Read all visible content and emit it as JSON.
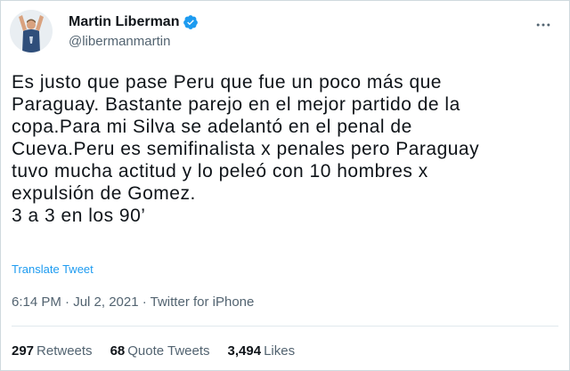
{
  "author": {
    "display_name": "Martin Liberman",
    "handle": "@libermanmartin",
    "verified": true
  },
  "tweet": {
    "lines": [
      "Es justo que pase Peru que fue un poco más que",
      "Paraguay. Bastante parejo en el mejor partido de la",
      "copa.Para mi Silva se adelantó en el penal de",
      "Cueva.Peru es semifinalista x penales pero Paraguay",
      "tuvo mucha actitud y lo peleó con 10 hombres x",
      "expulsión de Gomez.",
      "3 a 3 en los 90’"
    ],
    "translate_label": "Translate Tweet",
    "meta": "6:14 PM · Jul 2, 2021 · Twitter for iPhone"
  },
  "stats": {
    "retweets": {
      "count": "297",
      "label": "Retweets"
    },
    "quote_tweets": {
      "count": "68",
      "label": "Quote Tweets"
    },
    "likes": {
      "count": "3,494",
      "label": "Likes"
    }
  },
  "icons": {
    "more": "more-horizontal-icon",
    "verified": "verified-badge-icon"
  },
  "colors": {
    "accent": "#1d9bf0",
    "text": "#0f1419",
    "secondary": "#536471"
  }
}
